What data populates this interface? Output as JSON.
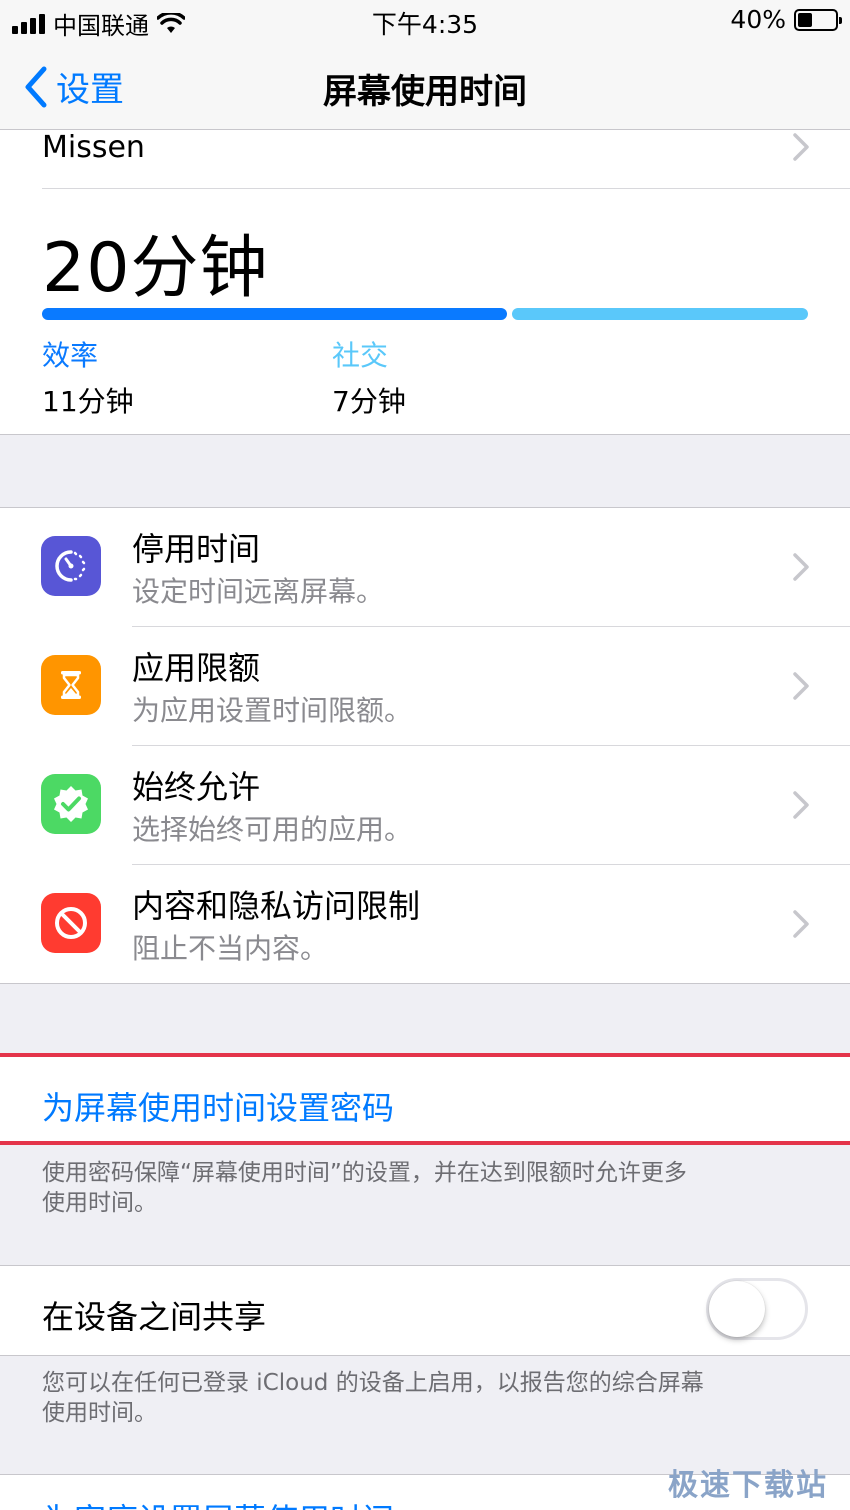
{
  "status_bar": {
    "carrier": "中国联通",
    "time": "下午4:35",
    "battery_text": "40%",
    "battery_level": 0.4,
    "signal_icon": "signal-bars-icon",
    "wifi_icon": "wifi-icon"
  },
  "nav": {
    "back_label": "设置",
    "title": "屏幕使用时间"
  },
  "summary": {
    "user_name": "Missen",
    "total_time": "20分钟",
    "categories": [
      {
        "label": "效率",
        "value": "11分钟",
        "minutes": 11,
        "color": "#0a7aff"
      },
      {
        "label": "社交",
        "value": "7分钟",
        "minutes": 7,
        "color": "#5ac8fa"
      }
    ]
  },
  "features": [
    {
      "title": "停用时间",
      "subtitle": "设定时间远离屏幕。",
      "icon": "downtime-icon",
      "color": "#5856d6"
    },
    {
      "title": "应用限额",
      "subtitle": "为应用设置时间限额。",
      "icon": "hourglass-icon",
      "color": "#ff9500"
    },
    {
      "title": "始终允许",
      "subtitle": "选择始终可用的应用。",
      "icon": "checkmark-badge-icon",
      "color": "#4cd964"
    },
    {
      "title": "内容和隐私访问限制",
      "subtitle": "阻止不当内容。",
      "icon": "prohibited-icon",
      "color": "#ff3b30"
    }
  ],
  "passcode": {
    "link": "为屏幕使用时间设置密码",
    "footnote_line1": "使用密码保障“屏幕使用时间”的设置，并在达到限额时允许更多",
    "footnote_line2": "使用时间。"
  },
  "share": {
    "label": "在设备之间共享",
    "enabled": false,
    "footnote_line1": "您可以在任何已登录 iCloud 的设备上启用，以报告您的综合屏幕",
    "footnote_line2": "使用时间。"
  },
  "bottom": {
    "link": "为家庭设置屏幕使用时间"
  },
  "watermark": "极速下载站",
  "colors": {
    "accent": "#007aff",
    "highlight_border": "#e4344a"
  }
}
